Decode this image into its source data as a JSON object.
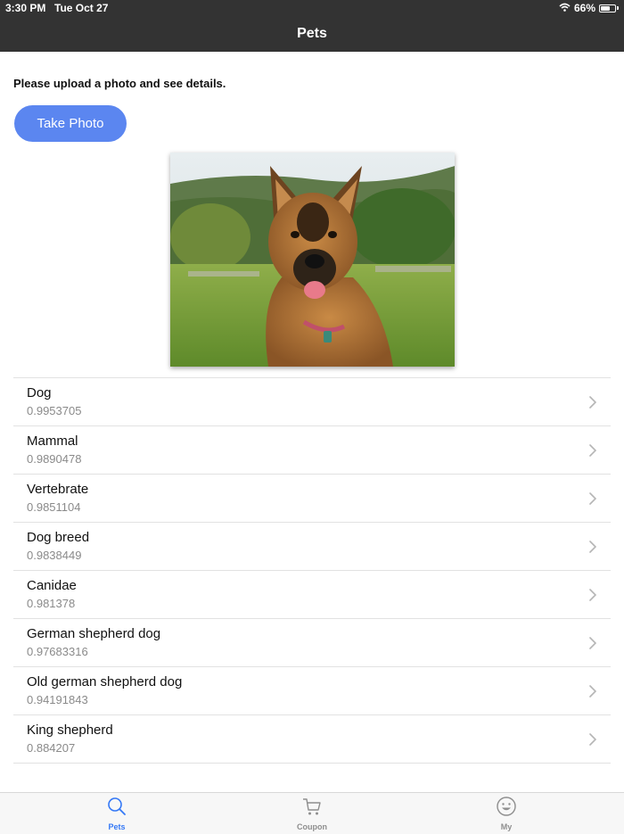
{
  "status": {
    "time": "3:30 PM",
    "date": "Tue Oct 27",
    "battery": "66%",
    "battery_level": 0.66
  },
  "nav": {
    "title": "Pets"
  },
  "main": {
    "prompt": "Please upload a photo and see details.",
    "take_photo_label": "Take Photo"
  },
  "results": [
    {
      "label": "Dog",
      "score": "0.9953705"
    },
    {
      "label": "Mammal",
      "score": "0.9890478"
    },
    {
      "label": "Vertebrate",
      "score": "0.9851104"
    },
    {
      "label": "Dog breed",
      "score": "0.9838449"
    },
    {
      "label": "Canidae",
      "score": "0.981378"
    },
    {
      "label": "German shepherd dog",
      "score": "0.97683316"
    },
    {
      "label": "Old german shepherd dog",
      "score": "0.94191843"
    },
    {
      "label": "King shepherd",
      "score": "0.884207"
    }
  ],
  "tabs": [
    {
      "label": "Pets",
      "icon": "search-icon",
      "active": true
    },
    {
      "label": "Coupon",
      "icon": "cart-icon",
      "active": false
    },
    {
      "label": "My",
      "icon": "smiley-icon",
      "active": false
    }
  ],
  "colors": {
    "accent": "#3478f6",
    "button": "#5b86f0",
    "topbar": "#333333"
  }
}
